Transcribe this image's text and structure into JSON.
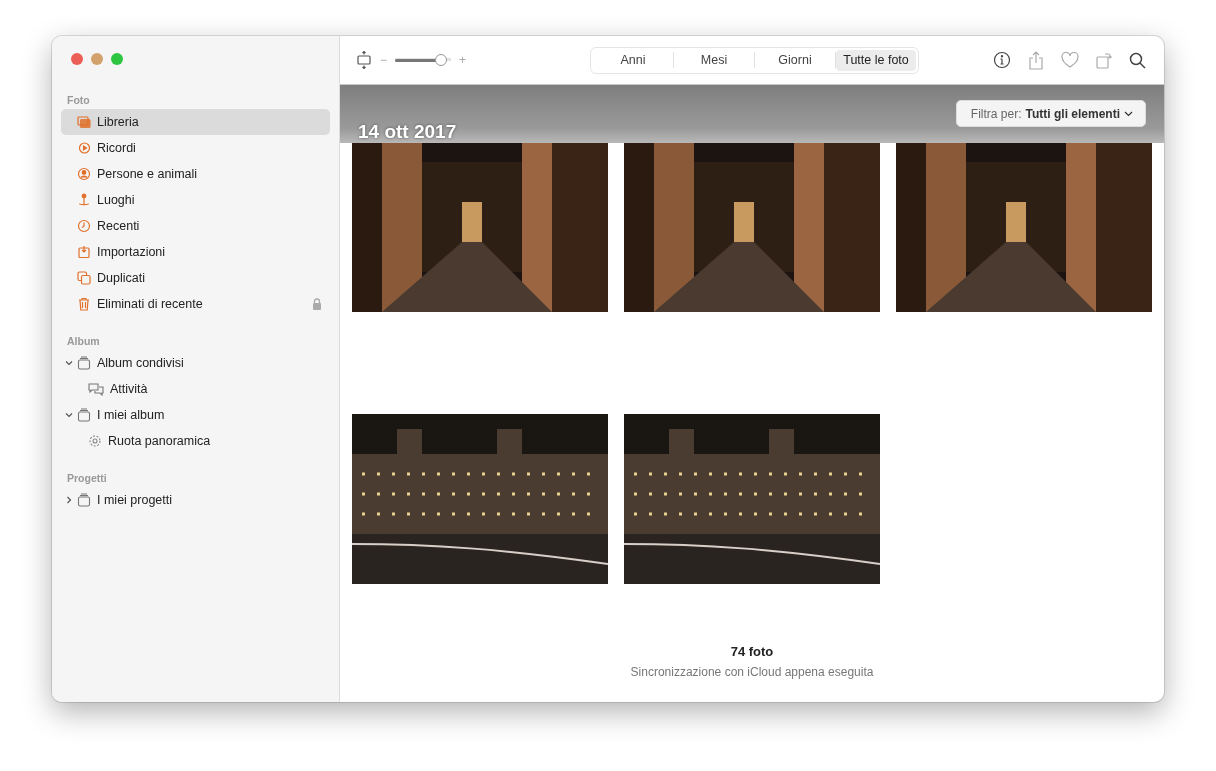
{
  "sidebar": {
    "sections": [
      {
        "title": "Foto",
        "items": [
          {
            "label": "Libreria",
            "selected": true,
            "locked": false
          },
          {
            "label": "Ricordi",
            "selected": false,
            "locked": false
          },
          {
            "label": "Persone e animali",
            "selected": false,
            "locked": false
          },
          {
            "label": "Luoghi",
            "selected": false,
            "locked": false
          },
          {
            "label": "Recenti",
            "selected": false,
            "locked": false
          },
          {
            "label": "Importazioni",
            "selected": false,
            "locked": false
          },
          {
            "label": "Duplicati",
            "selected": false,
            "locked": false
          },
          {
            "label": "Eliminati di recente",
            "selected": false,
            "locked": true
          }
        ]
      },
      {
        "title": "Album",
        "items": [
          {
            "label": "Album condivisi",
            "selected": false,
            "expanded": true,
            "children": [
              {
                "label": "Attività",
                "selected": false
              }
            ]
          },
          {
            "label": "I miei album",
            "selected": false,
            "expanded": true,
            "children": [
              {
                "label": "Ruota panoramica",
                "selected": false
              }
            ]
          }
        ]
      },
      {
        "title": "Progetti",
        "items": [
          {
            "label": "I miei progetti",
            "selected": false,
            "expanded": false
          }
        ]
      }
    ]
  },
  "toolbar": {
    "zoom": {
      "minus": "−",
      "plus": "+",
      "level": 0.9
    },
    "tabs": [
      {
        "label": "Anni",
        "selected": false
      },
      {
        "label": "Mesi",
        "selected": false
      },
      {
        "label": "Giorni",
        "selected": false
      },
      {
        "label": "Tutte le foto",
        "selected": true
      }
    ]
  },
  "filter": {
    "label": "Filtra per:",
    "value": "Tutti gli elementi"
  },
  "date_heading": "14 ott 2017",
  "photos": [
    {
      "kind": "corridor"
    },
    {
      "kind": "corridor"
    },
    {
      "kind": "corridor"
    },
    {
      "kind": "building"
    },
    {
      "kind": "building"
    }
  ],
  "footer": {
    "count": "74 foto",
    "status": "Sincronizzazione con iCloud appena eseguita"
  }
}
